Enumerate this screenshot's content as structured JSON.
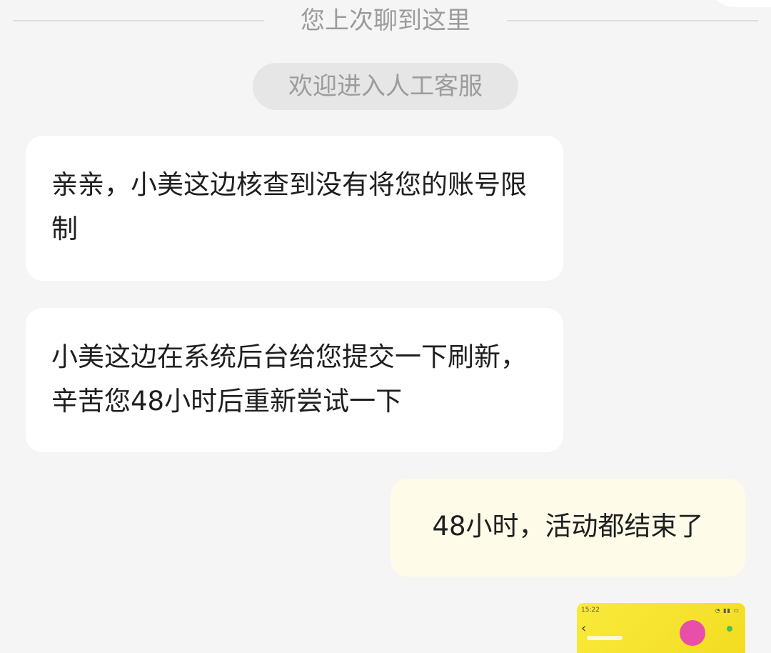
{
  "divider": {
    "text": "您上次聊到这里"
  },
  "system": {
    "pill_text": "欢迎进入人工客服"
  },
  "messages": [
    {
      "sender": "agent",
      "text": "亲亲，小美这边核查到没有将您的账号限制"
    },
    {
      "sender": "agent",
      "text": "小美这边在系统后台给您提交一下刷新，辛苦您48小时后重新尝试一下"
    },
    {
      "sender": "user",
      "text": "48小时，活动都结束了"
    }
  ],
  "image_message": {
    "status_time": "15:22",
    "back_icon": "chevron-left-icon"
  },
  "colors": {
    "background": "#f5f5f5",
    "agent_bubble": "#ffffff",
    "user_bubble": "#fefbe9",
    "system_pill": "#e6e6e6",
    "muted_text": "#9b9b9b",
    "thumbnail_yellow": "#f9ea3a"
  }
}
